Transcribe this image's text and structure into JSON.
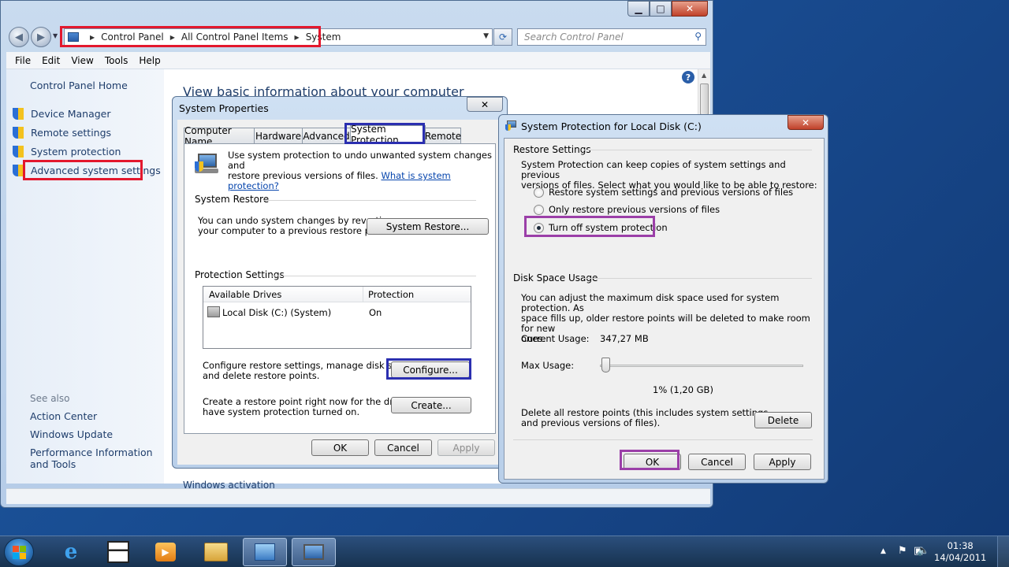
{
  "window": {
    "breadcrumbs": [
      "Control Panel",
      "All Control Panel Items",
      "System"
    ],
    "search_placeholder": "Search Control Panel",
    "menu": [
      "File",
      "Edit",
      "View",
      "Tools",
      "Help"
    ],
    "sidebar": {
      "home": "Control Panel Home",
      "links": [
        "Device Manager",
        "Remote settings",
        "System protection",
        "Advanced system settings"
      ],
      "see_also_label": "See also",
      "see_also": [
        "Action Center",
        "Windows Update",
        "Performance Information and Tools"
      ]
    },
    "main_title": "View basic information about your computer",
    "activation": "Windows activation"
  },
  "sysprops": {
    "title": "System Properties",
    "tabs": [
      "Computer Name",
      "Hardware",
      "Advanced",
      "System Protection",
      "Remote"
    ],
    "intro_line1": "Use system protection to undo unwanted system changes and",
    "intro_line2": "restore previous versions of files.",
    "intro_link": "What is system protection?",
    "restore_group": "System Restore",
    "restore_text1": "You can undo system changes by reverting",
    "restore_text2": "your computer to a previous restore point.",
    "restore_btn": "System Restore...",
    "protection_group": "Protection Settings",
    "col_drives": "Available Drives",
    "col_protection": "Protection",
    "drive_name": "Local Disk (C:) (System)",
    "drive_protection": "On",
    "configure_text1": "Configure restore settings, manage disk space,",
    "configure_text2": "and delete restore points.",
    "configure_btn": "Configure...",
    "create_text1": "Create a restore point right now for the drives that",
    "create_text2": "have system protection turned on.",
    "create_btn": "Create...",
    "ok": "OK",
    "cancel": "Cancel",
    "apply": "Apply"
  },
  "protection_dialog": {
    "title": "System Protection for Local Disk (C:)",
    "restore_group": "Restore Settings",
    "restore_desc1": "System Protection can keep copies of system settings and previous",
    "restore_desc2": "versions of files. Select what you would like to be able to restore:",
    "options": [
      "Restore system settings and previous versions of files",
      "Only restore previous versions of files",
      "Turn off system protection"
    ],
    "selected_option": 2,
    "disk_group": "Disk Space Usage",
    "disk_desc1": "You can adjust the maximum disk space used for system protection. As",
    "disk_desc2": "space fills up, older restore points will be deleted to make room for new",
    "disk_desc3": "ones.",
    "current_usage_label": "Current Usage:",
    "current_usage_value": "347,27 MB",
    "max_usage_label": "Max Usage:",
    "max_usage_percent": 0.01,
    "max_usage_value": "1% (1,20 GB)",
    "delete_text1": "Delete all restore points (this includes system settings",
    "delete_text2": "and previous versions of files).",
    "delete_btn": "Delete",
    "ok": "OK",
    "cancel": "Cancel",
    "apply": "Apply"
  },
  "taskbar": {
    "time": "01:38",
    "date": "14/04/2011"
  },
  "colors": {
    "red_highlight": "#e3182d",
    "blue_highlight": "#2b2fb0",
    "purple_highlight": "#9b3fa8"
  }
}
